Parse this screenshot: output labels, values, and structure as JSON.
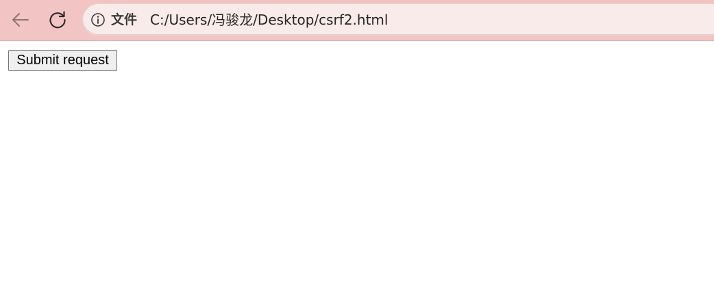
{
  "browser": {
    "toolbar_color": "#f2c4c4",
    "address_bar_color": "#f9ebea",
    "back_icon": "back-arrow-icon",
    "reload_icon": "reload-icon",
    "info_icon": "info-icon",
    "scheme_label": "文件",
    "url": "C:/Users/冯骏龙/Desktop/csrf2.html"
  },
  "page": {
    "submit_label": "Submit request"
  }
}
